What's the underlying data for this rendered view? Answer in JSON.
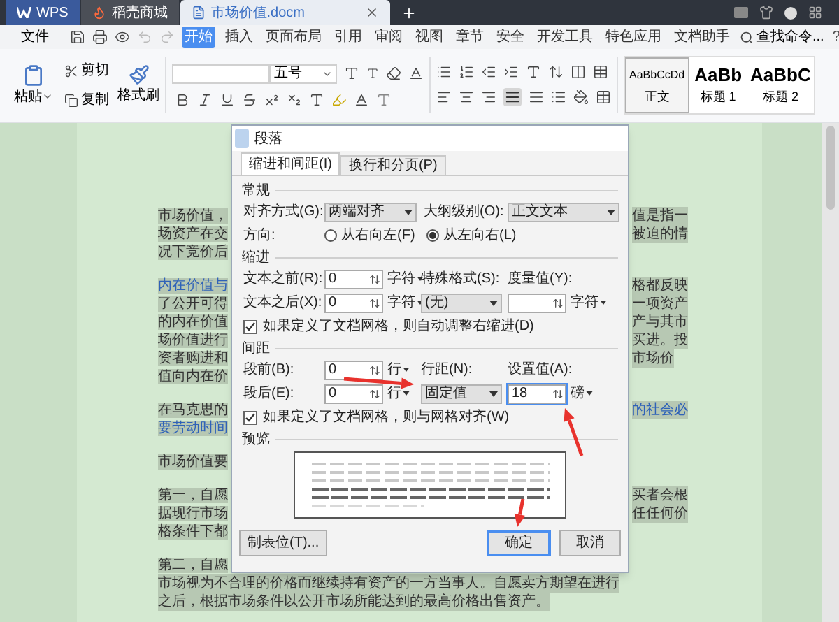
{
  "tabs": [
    {
      "kind": "wps",
      "label": "WPS",
      "selected": false
    },
    {
      "kind": "store",
      "label": "稻壳商城",
      "selected": false
    },
    {
      "kind": "doc",
      "label": "市场价值.docm",
      "selected": true
    }
  ],
  "menu": {
    "file": "文件",
    "items": [
      {
        "label": "开始",
        "selected": true
      },
      {
        "label": "插入",
        "selected": false
      },
      {
        "label": "页面布局",
        "selected": false
      },
      {
        "label": "引用",
        "selected": false
      },
      {
        "label": "审阅",
        "selected": false
      },
      {
        "label": "视图",
        "selected": false
      },
      {
        "label": "章节",
        "selected": false
      },
      {
        "label": "安全",
        "selected": false
      },
      {
        "label": "开发工具",
        "selected": false
      },
      {
        "label": "特色应用",
        "selected": false
      },
      {
        "label": "文档助手",
        "selected": false
      }
    ],
    "search": "查找命令...",
    "help": "?"
  },
  "ribbon": {
    "paste": "粘贴",
    "cut": "剪切",
    "copy": "复制",
    "format_painter": "格式刷",
    "font_size": "五号",
    "styles": [
      {
        "kind": "normal",
        "sample": "AaBbCcDd",
        "name": "正文",
        "selected": true
      },
      {
        "kind": "heading",
        "sample": "AaBb",
        "name": "标题 1",
        "selected": false
      },
      {
        "kind": "heading",
        "sample": "AaBbC",
        "name": "标题 2",
        "selected": false
      }
    ]
  },
  "document": {
    "paragraphs": [
      {
        "lines": [
          {
            "left": {
              "text": "市场价值，",
              "link": false
            },
            "right": {
              "text": "值是指一",
              "link": false
            }
          },
          {
            "left": {
              "text": "场资产在交",
              "link": false
            },
            "right": {
              "text": "被迫的情",
              "link": false
            }
          },
          {
            "left": {
              "text": "况下竞价后",
              "link": false
            }
          }
        ]
      },
      {
        "lines": [
          {
            "left": {
              "text": "内在价值与",
              "link": true
            },
            "right": {
              "text": "格都反映",
              "link": false
            }
          },
          {
            "left": {
              "text": "了公开可得",
              "link": false
            },
            "right": {
              "text": "一项资产",
              "link": false
            }
          },
          {
            "left": {
              "text": "的内在价值",
              "link": false
            },
            "right": {
              "text": "产与其市",
              "link": false
            }
          },
          {
            "left": {
              "text": "场价值进行",
              "link": false
            },
            "right": {
              "text": "买进。投",
              "link": false
            }
          },
          {
            "left": {
              "text": "资者购进和",
              "link": false
            },
            "right": {
              "text": "市场价",
              "link": false
            }
          },
          {
            "left": {
              "text": "值向内在价",
              "link": false
            }
          }
        ]
      },
      {
        "lines": [
          {
            "left": {
              "text": "在马克思的",
              "link": false
            },
            "right": {
              "text": "的社会必",
              "link": true
            }
          },
          {
            "left": {
              "text": "要劳动时间",
              "link": true
            }
          }
        ]
      },
      {
        "lines": [
          {
            "left": {
              "text": "市场价值要",
              "link": false
            }
          }
        ]
      },
      {
        "lines": [
          {
            "left": {
              "text": "第一，自愿",
              "link": false
            },
            "right": {
              "text": "买者会根",
              "link": false
            }
          },
          {
            "left": {
              "text": "据现行市场",
              "link": false
            },
            "right": {
              "text": "任任何价",
              "link": false
            }
          },
          {
            "left": {
              "text": "格条件下都",
              "link": false
            }
          }
        ]
      },
      {
        "lines": [
          {
            "left": {
              "text": "第二，自愿",
              "link": false
            }
          },
          {
            "full": {
              "text": "市场视为不合理的价格而继续持有资产的一方当事人。自愿卖方期望在进行",
              "link": false
            }
          },
          {
            "full": {
              "text": "之后，根据市场条件以公开市场所能达到的最高价格出售资产。",
              "link": false
            }
          }
        ]
      }
    ]
  },
  "dialog": {
    "title": "段落",
    "tabs": [
      {
        "label": "缩进和间距(I)",
        "selected": true
      },
      {
        "label": "换行和分页(P)",
        "selected": false
      }
    ],
    "general": {
      "heading": "常规",
      "alignment": {
        "label": "对齐方式(G):",
        "value": "两端对齐"
      },
      "outline": {
        "label": "大纲级别(O):",
        "value": "正文文本"
      },
      "direction": {
        "label": "方向:",
        "options": [
          {
            "label": "从右向左(F)",
            "selected": false
          },
          {
            "label": "从左向右(L)",
            "selected": true
          }
        ]
      }
    },
    "indent": {
      "heading": "缩进",
      "before": {
        "label": "文本之前(R):",
        "value": "0",
        "unit": "字符"
      },
      "after": {
        "label": "文本之后(X):",
        "value": "0",
        "unit": "字符"
      },
      "special": {
        "label": "特殊格式(S):",
        "value": "(无)"
      },
      "measure": {
        "label": "度量值(Y):",
        "unit": "字符"
      },
      "auto_adjust": {
        "label": "如果定义了文档网格，则自动调整右缩进(D)",
        "checked": true
      }
    },
    "spacing": {
      "heading": "间距",
      "before": {
        "label": "段前(B):",
        "value": "0",
        "unit": "行"
      },
      "after": {
        "label": "段后(E):",
        "value": "0",
        "unit": "行"
      },
      "line_spacing": {
        "label": "行距(N):",
        "value": "固定值"
      },
      "set_value": {
        "label": "设置值(A):",
        "value": "18",
        "unit": "磅"
      },
      "snap_to_grid": {
        "label": "如果定义了文档网格，则与网格对齐(W)",
        "checked": true
      }
    },
    "preview": {
      "heading": "预览"
    },
    "buttons": {
      "tab_stops": "制表位(T)...",
      "ok": "确定",
      "cancel": "取消"
    }
  }
}
